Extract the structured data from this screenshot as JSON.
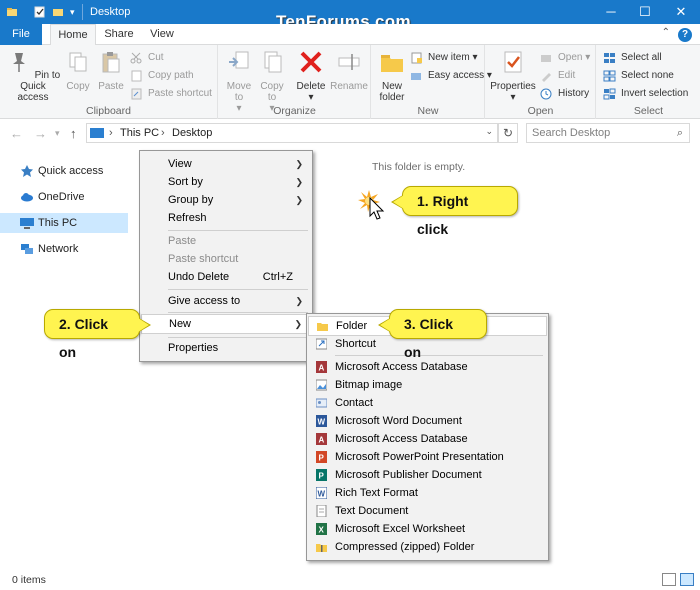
{
  "window": {
    "title": "Desktop",
    "watermark": "TenForums.com",
    "controls": [
      "minimize",
      "maximize",
      "close"
    ]
  },
  "ribbon_tabs": [
    "File",
    "Home",
    "Share",
    "View"
  ],
  "ribbon": {
    "clipboard": {
      "label": "Clipboard",
      "pin": "Pin to Quick access",
      "copy": "Copy",
      "paste": "Paste",
      "cut": "Cut",
      "copy_path": "Copy path",
      "paste_shortcut": "Paste shortcut"
    },
    "organize": {
      "label": "Organize",
      "move_to": "Move to",
      "copy_to": "Copy to",
      "delete": "Delete",
      "rename": "Rename"
    },
    "new": {
      "label": "New",
      "new_folder": "New folder",
      "new_item": "New item",
      "easy_access": "Easy access"
    },
    "open": {
      "label": "Open",
      "properties": "Properties",
      "open": "Open",
      "edit": "Edit",
      "history": "History"
    },
    "select": {
      "label": "Select",
      "select_all": "Select all",
      "select_none": "Select none",
      "invert": "Invert selection"
    }
  },
  "address": {
    "path": [
      "This PC",
      "Desktop"
    ],
    "search_placeholder": "Search Desktop"
  },
  "nav_items": [
    "Quick access",
    "OneDrive",
    "This PC",
    "Network"
  ],
  "content": {
    "empty_message": "This folder is empty."
  },
  "context_menu": {
    "view": "View",
    "sort_by": "Sort by",
    "group_by": "Group by",
    "refresh": "Refresh",
    "paste": "Paste",
    "paste_shortcut": "Paste shortcut",
    "undo_delete": "Undo Delete",
    "undo_shortcut": "Ctrl+Z",
    "give_access": "Give access to",
    "new": "New",
    "properties": "Properties"
  },
  "submenu": {
    "folder": "Folder",
    "shortcut": "Shortcut",
    "items": [
      "Microsoft Access Database",
      "Bitmap image",
      "Contact",
      "Microsoft Word Document",
      "Microsoft Access Database",
      "Microsoft PowerPoint Presentation",
      "Microsoft Publisher Document",
      "Rich Text Format",
      "Text Document",
      "Microsoft Excel Worksheet",
      "Compressed (zipped) Folder"
    ]
  },
  "callouts": {
    "step1": "1. Right click",
    "step2": "2. Click on",
    "step3": "3. Click on"
  },
  "status": {
    "item_count": "0 items"
  },
  "colors": {
    "title_bar": "#1979ca",
    "callout": "#fff450",
    "nav_selected": "#cce8ff"
  }
}
